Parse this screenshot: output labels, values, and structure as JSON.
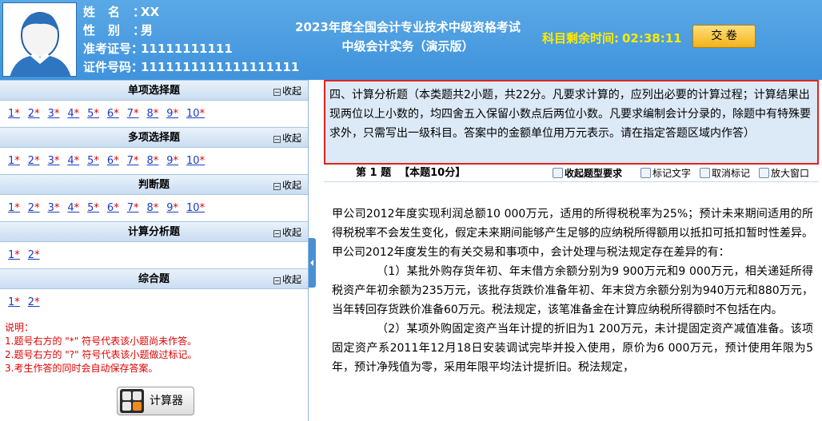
{
  "candidate": {
    "name_label": "姓名：",
    "name": "XX",
    "gender_label": "性别：",
    "gender": "男",
    "exam_id_label": "准考证号：",
    "exam_id": "11111111111",
    "cert_label": "证件号码：",
    "cert_id": "1111111111111111111"
  },
  "exam": {
    "title_line1": "2023年度全国会计专业技术中级资格考试",
    "title_line2": "中级会计实务（演示版）",
    "timer_label": "科目剩余时间:",
    "timer_value": "02:38:11",
    "submit_label": "交 卷"
  },
  "sidebar": {
    "collapse_label": "收起",
    "sections": [
      {
        "title": "单项选择题",
        "questions": [
          "1",
          "2",
          "3",
          "4",
          "5",
          "6",
          "7",
          "8",
          "9",
          "10"
        ]
      },
      {
        "title": "多项选择题",
        "questions": [
          "1",
          "2",
          "3",
          "4",
          "5",
          "6",
          "7",
          "8",
          "9",
          "10"
        ]
      },
      {
        "title": "判断题",
        "questions": [
          "1",
          "2",
          "3",
          "4",
          "5",
          "6",
          "7",
          "8",
          "9",
          "10"
        ]
      },
      {
        "title": "计算分析题",
        "questions": [
          "1",
          "2"
        ]
      },
      {
        "title": "综合题",
        "questions": [
          "1",
          "2"
        ]
      }
    ],
    "unanswered_mark": "*",
    "notes": [
      "说明：",
      "1.题号右方的 \"*\" 符号代表该小题尚未作答。",
      "2.题号右方的 \"?\" 符号代表该小题做过标记。",
      "3.考生作答的同时会自动保存答案。"
    ],
    "calculator_label": "计算器"
  },
  "main": {
    "section_description": "四、计算分析题（本类题共2小题，共22分。凡要求计算的，应列出必要的计算过程；计算结果出现两位以上小数的，均四舍五入保留小数点后两位小数。凡要求编制会计分录的，除题中有特殊要求外，只需写出一级科目。答案中的金额单位用万元表示。请在指定答题区域内作答）",
    "question_number": "第 1 题",
    "question_score": "【本题10分】",
    "tools": {
      "collapse_requirement": "收起题型要求",
      "mark_text": "标记文字",
      "unmark": "取消标记",
      "zoom_window": "放大窗口"
    },
    "paragraphs": [
      "甲公司2012年度实现利润总额10 000万元，适用的所得税税率为25%；预计未来期间适用的所得税税率不会发生变化，假定未来期间能够产生足够的应纳税所得额用以抵扣可抵扣暂时性差异。甲公司2012年度发生的有关交易和事项中，会计处理与税法规定存在差异的有：",
      "（1）某批外购存货年初、年末借方余额分别为9 900万元和9 000万元，相关递延所得税资产年初余额为235万元，该批存货跌价准备年初、年末贷方余额分别为940万元和880万元，当年转回存货跌价准备60万元。税法规定，该笔准备金在计算应纳税所得额时不包括在内。",
      "（2）某项外购固定资产当年计提的折旧为1 200万元，未计提固定资产减值准备。该项固定资产系2011年12月18日安装调试完毕并投入使用，原价为6 000万元，预计使用年限为5年，预计净残值为零，采用年限平均法计提折旧。税法规定，"
    ]
  },
  "colors": {
    "header_blue": "#4a9de2",
    "timer_yellow": "#ffea00",
    "link_blue": "#1a3cc4",
    "unanswered_red": "#e00000",
    "highlight_border": "#e0231c",
    "description_bg": "#dce9f7"
  }
}
